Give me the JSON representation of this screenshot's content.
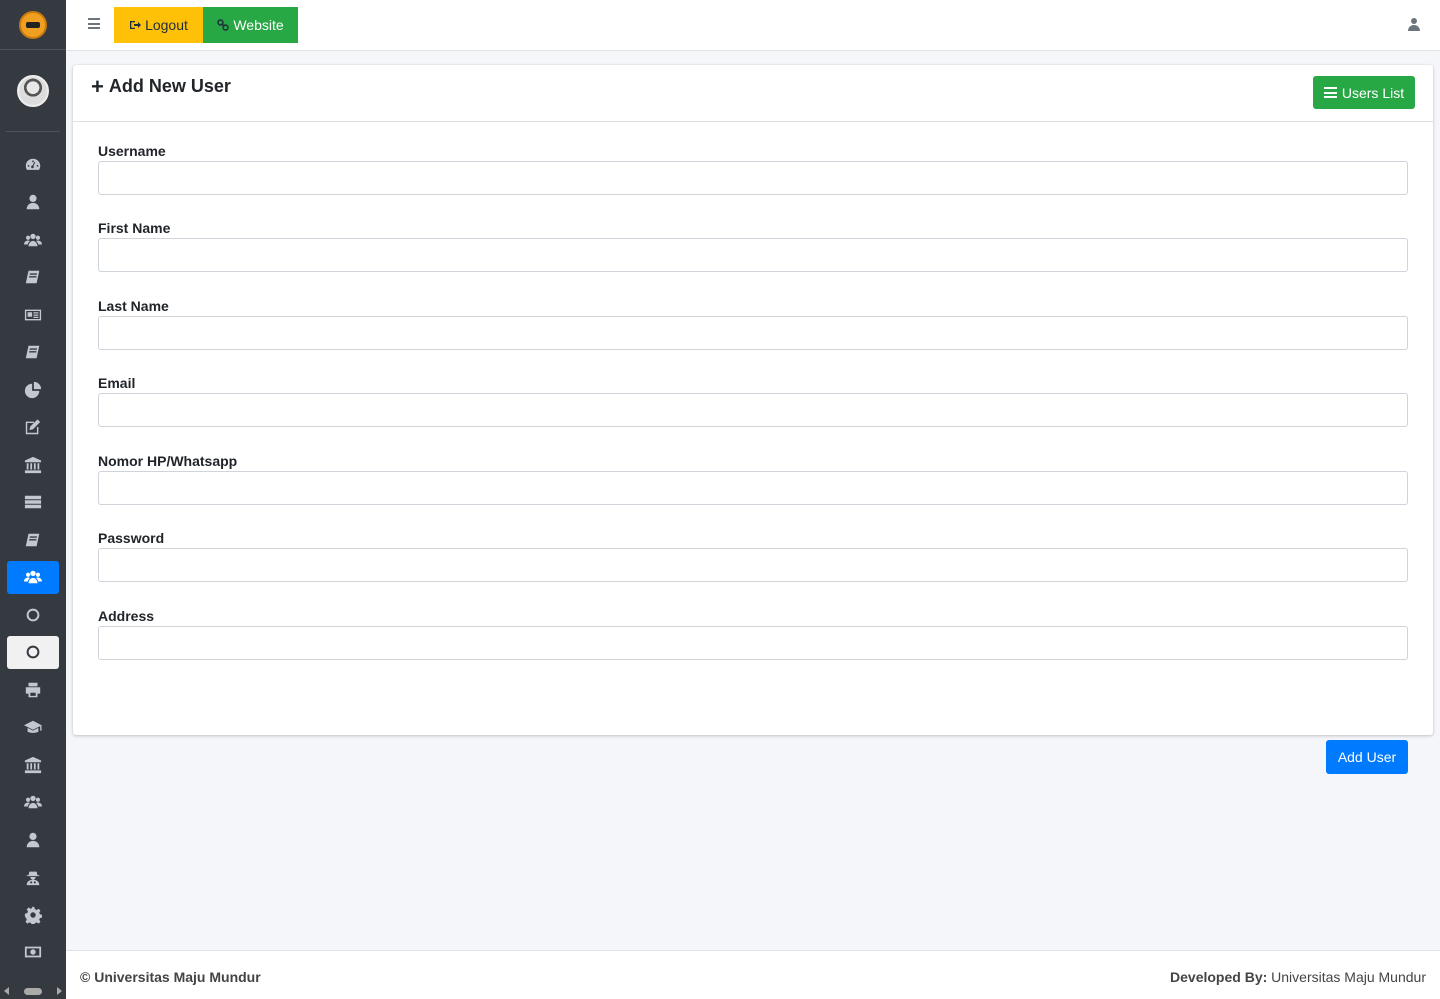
{
  "topbar": {
    "logout_label": "Logout",
    "website_label": "Website",
    "logout_color": "#ffc107",
    "website_color": "#28a745"
  },
  "sidebar": {
    "items": [
      {
        "icon": "dashboard-icon"
      },
      {
        "icon": "user-icon"
      },
      {
        "icon": "users-icon"
      },
      {
        "icon": "book-icon"
      },
      {
        "icon": "newspaper-icon"
      },
      {
        "icon": "book-icon"
      },
      {
        "icon": "pie-chart-icon"
      },
      {
        "icon": "edit-icon"
      },
      {
        "icon": "institution-icon"
      },
      {
        "icon": "server-icon"
      },
      {
        "icon": "book-icon"
      },
      {
        "icon": "users-icon",
        "active": true
      },
      {
        "icon": "circle-icon"
      },
      {
        "icon": "circle-icon",
        "highlighted": true
      },
      {
        "icon": "print-icon"
      },
      {
        "icon": "graduation-cap-icon"
      },
      {
        "icon": "institution-icon"
      },
      {
        "icon": "users-icon"
      },
      {
        "icon": "user-icon"
      },
      {
        "icon": "user-secret-icon"
      },
      {
        "icon": "gear-icon"
      },
      {
        "icon": "money-icon"
      }
    ],
    "active_color": "#007bff"
  },
  "card": {
    "title": "Add New User",
    "users_list_label": "Users List"
  },
  "form": {
    "fields": [
      {
        "label": "Username",
        "value": ""
      },
      {
        "label": "First Name",
        "value": ""
      },
      {
        "label": "Last Name",
        "value": ""
      },
      {
        "label": "Email",
        "value": ""
      },
      {
        "label": "Nomor HP/Whatsapp",
        "value": ""
      },
      {
        "label": "Password",
        "value": ""
      },
      {
        "label": "Address",
        "value": ""
      }
    ],
    "submit_label": "Add User",
    "submit_color": "#007bff"
  },
  "footer": {
    "copyright": "© Universitas Maju Mundur",
    "developed_by_label": "Developed By:",
    "developed_by_value": "Universitas Maju Mundur"
  }
}
